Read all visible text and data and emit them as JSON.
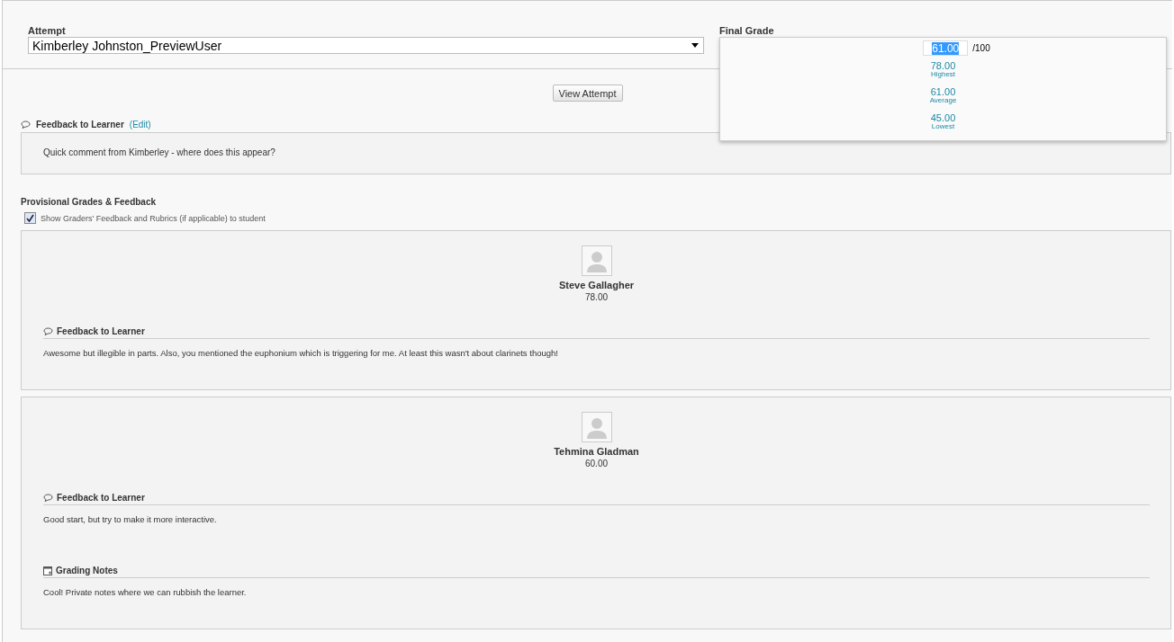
{
  "attempt": {
    "label": "Attempt",
    "value": "Kimberley Johnston_PreviewUser"
  },
  "final_grade": {
    "label": "Final Grade",
    "value": "61.00",
    "out_of": "/100",
    "stats": [
      {
        "value": "78.00",
        "label": "Highest"
      },
      {
        "value": "61.00",
        "label": "Average"
      },
      {
        "value": "45.00",
        "label": "Lowest"
      }
    ]
  },
  "view_attempt_button": "View Attempt",
  "feedback": {
    "title": "Feedback to Learner",
    "edit_link": "(Edit)",
    "text": "Quick comment from Kimberley - where does this appear?"
  },
  "provisional": {
    "title": "Provisional Grades & Feedback",
    "show_feedback": {
      "label": "Show Graders' Feedback and Rubrics (if applicable) to student",
      "checked": true
    },
    "graders": [
      {
        "name": "Steve Gallagher",
        "grade": "78.00",
        "sections": [
          {
            "kind": "feedback",
            "title": "Feedback to Learner",
            "text": "Awesome but illegible in parts. Also, you mentioned the euphonium which is triggering for me. At least this wasn't about clarinets though!"
          }
        ]
      },
      {
        "name": "Tehmina Gladman",
        "grade": "60.00",
        "sections": [
          {
            "kind": "feedback",
            "title": "Feedback to Learner",
            "text": "Good start, but try to make it more interactive."
          },
          {
            "kind": "notes",
            "title": "Grading Notes",
            "text": "Cool! Private notes where we can rubbish the learner."
          }
        ]
      }
    ]
  }
}
